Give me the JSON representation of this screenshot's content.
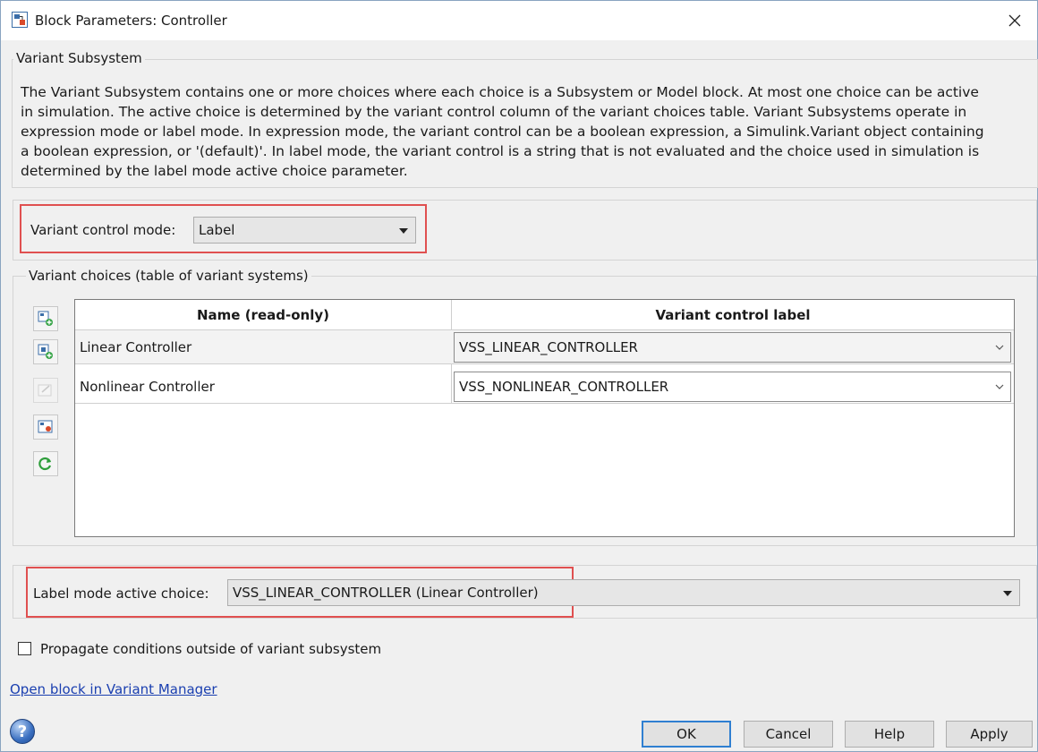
{
  "window": {
    "title": "Block Parameters: Controller"
  },
  "description_group": {
    "legend": "Variant Subsystem",
    "lines": [
      "The Variant Subsystem contains one or more choices where each choice is a Subsystem or Model block. At most one choice can be active",
      "in simulation. The active choice is determined by the variant control column of the variant choices table. Variant Subsystems operate in",
      "expression mode or label mode. In expression mode, the variant control can be a boolean expression, a Simulink.Variant object containing",
      "a boolean expression, or '(default)'. In label mode, the variant control is a string that is not evaluated and the choice used in simulation is",
      "determined by the label mode active choice parameter."
    ]
  },
  "variant_control_mode": {
    "label": "Variant control mode:",
    "value": "Label"
  },
  "choices_group": {
    "legend": "Variant choices (table of variant systems)",
    "side_buttons": [
      "add-subsystem-choice-icon",
      "add-model-choice-icon",
      "edit-choice-icon",
      "open-choice-icon",
      "refresh-icon"
    ],
    "table": {
      "headers": [
        "Name (read-only)",
        "Variant control label"
      ],
      "rows": [
        {
          "name": "Linear Controller",
          "control": "VSS_LINEAR_CONTROLLER"
        },
        {
          "name": "Nonlinear Controller",
          "control": "VSS_NONLINEAR_CONTROLLER"
        }
      ]
    }
  },
  "label_mode_active_choice": {
    "label": "Label mode active choice:",
    "value": "VSS_LINEAR_CONTROLLER (Linear Controller)"
  },
  "propagate_conditions": {
    "label": "Propagate conditions outside of variant subsystem",
    "checked": false
  },
  "variant_manager_link": "Open block in Variant Manager",
  "buttons": {
    "ok": "OK",
    "cancel": "Cancel",
    "help": "Help",
    "apply": "Apply"
  },
  "colors": {
    "highlight_box": "#e05050",
    "default_button_border": "#2f7fd1",
    "link": "#1a3fb0"
  }
}
